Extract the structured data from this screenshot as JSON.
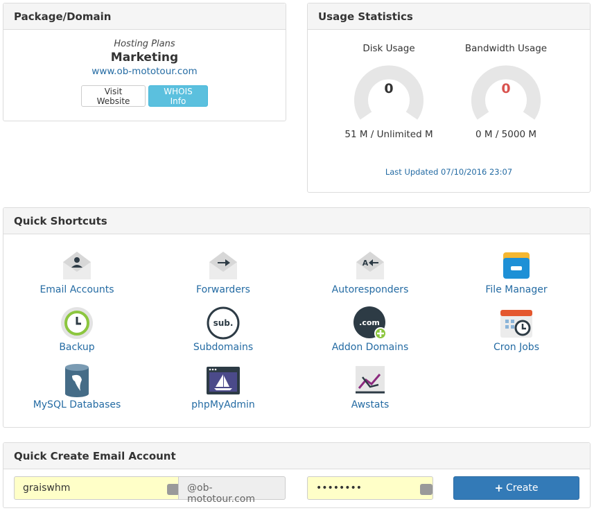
{
  "package": {
    "title": "Package/Domain",
    "plans_label": "Hosting Plans",
    "plan_name": "Marketing",
    "domain": "www.ob-mototour.com",
    "visit_label": "Visit Website",
    "whois_label": "WHOIS Info"
  },
  "usage": {
    "title": "Usage Statistics",
    "disk": {
      "title": "Disk Usage",
      "value": "0",
      "limit": "51 M / Unlimited M",
      "fraction": 0
    },
    "bandwidth": {
      "title": "Bandwidth Usage",
      "value": "0",
      "limit": "0 M / 5000 M",
      "fraction": 0
    },
    "last_updated": "Last Updated 07/10/2016 23:07"
  },
  "shortcuts": {
    "title": "Quick Shortcuts",
    "items": [
      {
        "label": "Email Accounts",
        "icon": "email-accounts-icon"
      },
      {
        "label": "Forwarders",
        "icon": "forwarders-icon"
      },
      {
        "label": "Autoresponders",
        "icon": "autoresponders-icon"
      },
      {
        "label": "File Manager",
        "icon": "file-manager-icon"
      },
      {
        "label": "Backup",
        "icon": "backup-icon"
      },
      {
        "label": "Subdomains",
        "icon": "subdomains-icon",
        "icon_text": "sub."
      },
      {
        "label": "Addon Domains",
        "icon": "addon-domains-icon",
        "icon_text": ".com"
      },
      {
        "label": "Cron Jobs",
        "icon": "cron-jobs-icon"
      },
      {
        "label": "MySQL Databases",
        "icon": "mysql-databases-icon"
      },
      {
        "label": "phpMyAdmin",
        "icon": "phpmyadmin-icon"
      },
      {
        "label": "Awstats",
        "icon": "awstats-icon"
      }
    ]
  },
  "quick_create": {
    "title": "Quick Create Email Account",
    "username": "graiswhm",
    "domain_suffix": "@ob-mototour.com",
    "password_mask": "••••••••",
    "create_label": "Create"
  },
  "colors": {
    "link": "#246ba3",
    "info": "#5bc0de",
    "primary": "#337ab7",
    "danger": "#d9534f",
    "autofill": "#ffffc8"
  }
}
